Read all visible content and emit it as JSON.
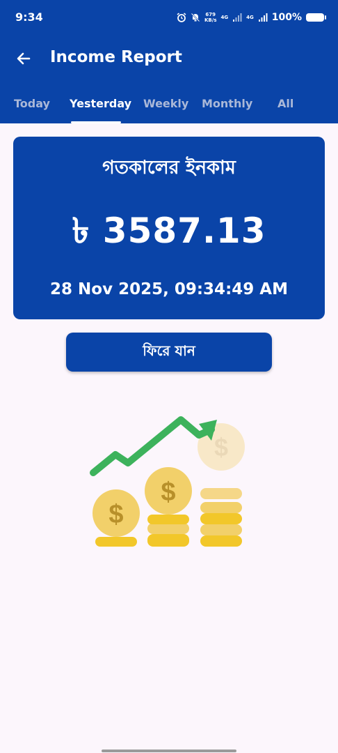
{
  "status_bar": {
    "time": "9:34",
    "net_speed_value": "679",
    "net_speed_unit": "KB/s",
    "network_1": "4G",
    "network_2": "4G",
    "battery": "100%"
  },
  "header": {
    "title": "Income Report",
    "back_icon": "back-arrow-icon"
  },
  "tabs": [
    {
      "label": "Today",
      "active": false
    },
    {
      "label": "Yesterday",
      "active": true
    },
    {
      "label": "Weekly",
      "active": false
    },
    {
      "label": "Monthly",
      "active": false
    },
    {
      "label": "All",
      "active": false
    }
  ],
  "income_card": {
    "heading": "গতকালের ইনকাম",
    "amount": "৳ 3587.13",
    "datetime": "28 Nov 2025, 09:34:49 AM"
  },
  "go_back_button": {
    "label": "ফিরে যান"
  },
  "illustration": {
    "icon": "income-growth-coins-illustration",
    "arrow_color": "#3db25c",
    "coin_color": "#f2c72a"
  },
  "colors": {
    "primary": "#0a44a8",
    "background": "#fcf6fc"
  }
}
